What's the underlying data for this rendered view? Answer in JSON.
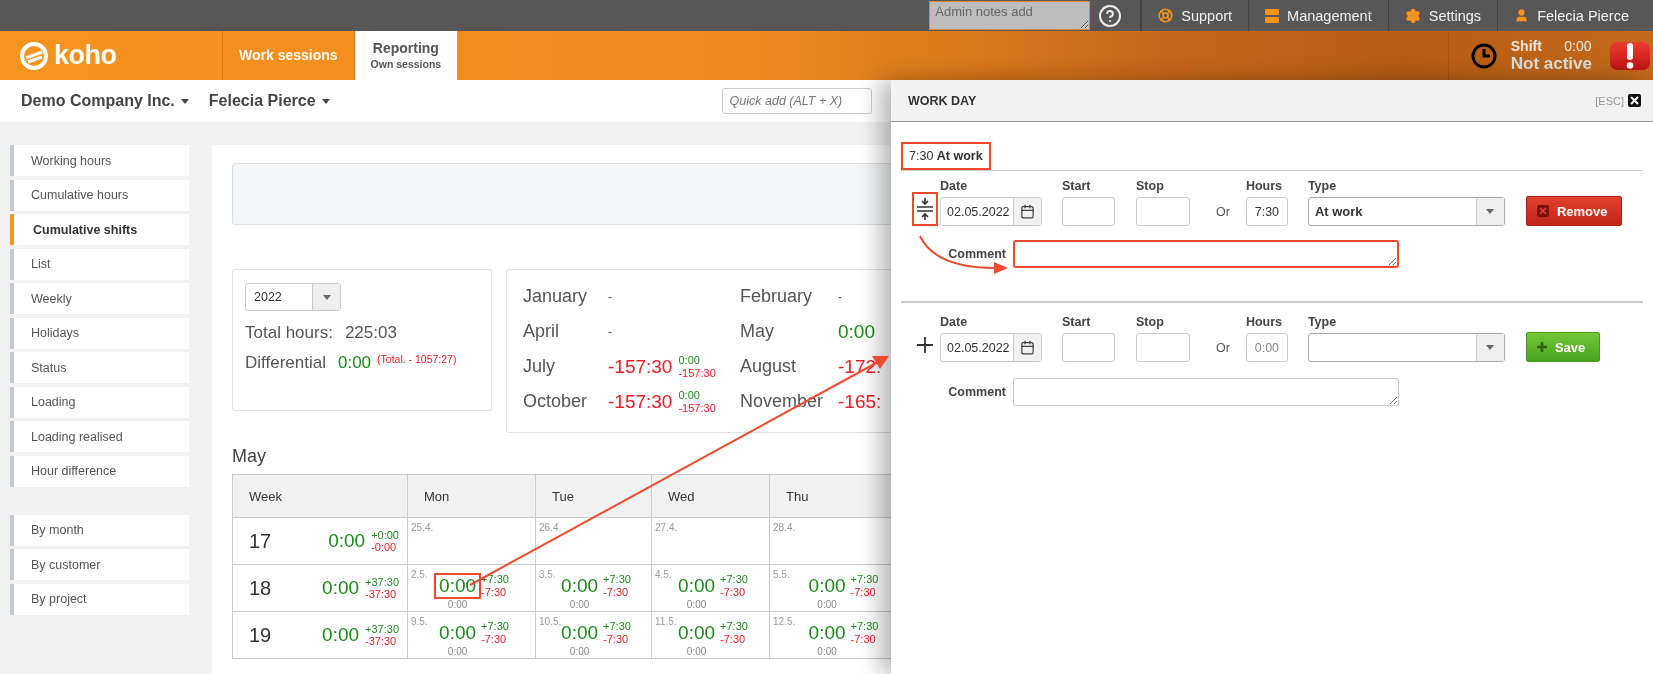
{
  "top_bar": {
    "admin_notes": {
      "placeholder": "Admin notes add"
    },
    "links": [
      {
        "kind": "support",
        "label": "Support"
      },
      {
        "kind": "management",
        "label": "Management"
      },
      {
        "kind": "settings",
        "label": "Settings"
      },
      {
        "kind": "user",
        "label": "Felecia Pierce"
      }
    ]
  },
  "header": {
    "logo": "koho",
    "tabs": [
      {
        "label": "Work sessions",
        "selected": false
      },
      {
        "label": "Reporting",
        "sublabel": "Own sessions",
        "selected": true
      }
    ],
    "shift": {
      "label": "Shift",
      "time": "0:00",
      "status": "Not active"
    }
  },
  "subheader": {
    "company": "Demo Company Inc.",
    "person": "Felecia Pierce",
    "quick_add": {
      "placeholder": "Quick add (ALT + X)"
    }
  },
  "sidebar": {
    "groups": [
      {
        "items": [
          {
            "label": "Working hours",
            "selected": false
          },
          {
            "label": "Cumulative hours",
            "selected": false
          },
          {
            "label": "Cumulative shifts",
            "selected": true
          },
          {
            "label": "List",
            "selected": false
          },
          {
            "label": "Weekly",
            "selected": false
          },
          {
            "label": "Holidays",
            "selected": false
          },
          {
            "label": "Status",
            "selected": false
          },
          {
            "label": "Loading",
            "selected": false
          },
          {
            "label": "Loading realised",
            "selected": false
          },
          {
            "label": "Hour difference",
            "selected": false
          }
        ]
      },
      {
        "items": [
          {
            "label": "By month",
            "selected": false
          },
          {
            "label": "By customer",
            "selected": false
          },
          {
            "label": "By project",
            "selected": false
          }
        ]
      }
    ]
  },
  "year_summary": {
    "year": "2022",
    "total_label": "Total hours:",
    "total": "225:03",
    "diff_label": "Differential",
    "diff": "0:00",
    "diff_note": "(Total. - 1057:27)"
  },
  "months": [
    {
      "name": "January",
      "value": "-"
    },
    {
      "name": "February",
      "value": "-"
    },
    {
      "name": "April",
      "value": "-"
    },
    {
      "name": "May",
      "value": "0:00",
      "color": "#1b8a1b"
    },
    {
      "name": "July",
      "value": "-157:30",
      "color": "#ec1c24",
      "plus": "0:00",
      "minus": "-157:30"
    },
    {
      "name": "August",
      "value": "-172:",
      "color": "#ec1c24"
    },
    {
      "name": "October",
      "value": "-157:30",
      "color": "#ec1c24",
      "plus": "0:00",
      "minus": "-157:30"
    },
    {
      "name": "November",
      "value": "-165:",
      "color": "#ec1c24"
    }
  ],
  "calendar": {
    "title": "May",
    "columns": [
      "Week",
      "Mon",
      "Tue",
      "Wed",
      "Thu"
    ],
    "rows": [
      {
        "week": "17",
        "total": "0:00",
        "plus": "+0:00",
        "minus": "-0:00",
        "days": [
          {
            "date": "25.4."
          },
          {
            "date": "26.4."
          },
          {
            "date": "27.4."
          },
          {
            "date": "28.4."
          }
        ]
      },
      {
        "week": "18",
        "total": "0:00",
        "plus": "+37:30",
        "minus": "-37:30",
        "days": [
          {
            "date": "2.5.",
            "value": "0:00",
            "plus": "+7:30",
            "minus": "-7:30",
            "planned": "0:00",
            "highlighted": true
          },
          {
            "date": "3.5.",
            "value": "0:00",
            "plus": "+7:30",
            "minus": "-7:30",
            "planned": "0:00",
            "highlighted": false
          },
          {
            "date": "4.5.",
            "value": "0:00",
            "plus": "+7:30",
            "minus": "-7:30",
            "planned": "0:00",
            "highlighted": false
          },
          {
            "date": "5.5.",
            "value": "0:00",
            "plus": "+7:30",
            "minus": "-7:30",
            "planned": "0:00",
            "highlighted": false
          }
        ]
      },
      {
        "week": "19",
        "total": "0:00",
        "plus": "+37:30",
        "minus": "-37:30",
        "days": [
          {
            "date": "9.5.",
            "value": "0:00",
            "plus": "+7:30",
            "minus": "-7:30",
            "planned": "0:00",
            "highlighted": false
          },
          {
            "date": "10.5.",
            "value": "0:00",
            "plus": "+7:30",
            "minus": "-7:30",
            "planned": "0:00",
            "highlighted": false
          },
          {
            "date": "11.5.",
            "value": "0:00",
            "plus": "+7:30",
            "minus": "-7:30",
            "planned": "0:00",
            "highlighted": false
          },
          {
            "date": "12.5.",
            "value": "0:00",
            "plus": "+7:30",
            "minus": "-7:30",
            "planned": "0:00",
            "highlighted": false
          }
        ]
      }
    ]
  },
  "work_day": {
    "title": "WORK DAY",
    "close_hint": "[ESC]",
    "summary": {
      "text": "7:30 **At work**",
      "highlighted": true
    },
    "forms": [
      {
        "kind": "existing",
        "icon_highlighted": true,
        "date_label": "Date",
        "date": "02.05.2022",
        "start_label": "Start",
        "stop_label": "Stop",
        "or_label": "Or",
        "hours_label": "Hours",
        "hours": "7:30",
        "type_label": "Type",
        "type": "At work",
        "action": "Remove",
        "comment_label": "Comment",
        "comment_highlighted": true
      },
      {
        "kind": "new",
        "icon_highlighted": false,
        "date_label": "Date",
        "date": "02.05.2022",
        "start_label": "Start",
        "stop_label": "Stop",
        "or_label": "Or",
        "hours_label": "Hours",
        "hours_placeholder": "0:00",
        "type_label": "Type",
        "action": "Save",
        "comment_label": "Comment",
        "comment_highlighted": false
      }
    ]
  }
}
